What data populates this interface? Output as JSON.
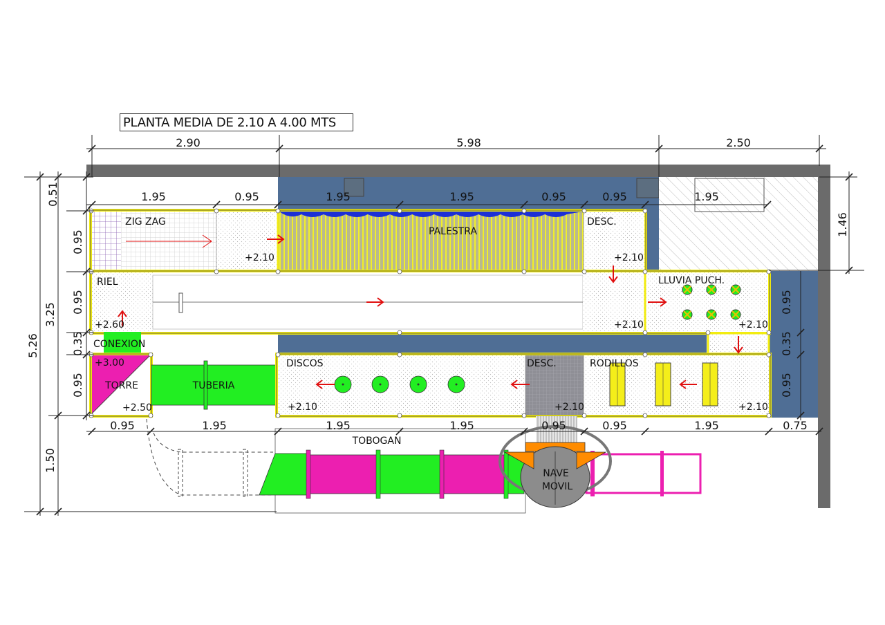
{
  "title": "PLANTA MEDIA DE 2.10 A 4.00 MTS",
  "colors": {
    "wall": "#6b6b6b",
    "blue": "#4f6e95",
    "yellow": "#f4ee1a",
    "green": "#22ee22",
    "magenta": "#ec1fb0",
    "orange": "#ff8c00",
    "arrow": "#e01010",
    "disc_gray": "#8c8c8c"
  },
  "dimensions": {
    "top": [
      "2.90",
      "5.98",
      "2.50"
    ],
    "row1": [
      "1.95",
      "0.95",
      "1.95",
      "1.95",
      "0.95",
      "0.95",
      "1.95"
    ],
    "row_bottom": [
      "0.95",
      "1.95",
      "1.95",
      "1.95",
      "0.95",
      "0.95",
      "1.95",
      "0.75"
    ],
    "left_outer": "5.26",
    "left_mid": [
      "3.25",
      "1.50"
    ],
    "left_inner": [
      "0.51",
      "0.95",
      "0.95",
      "0.35",
      "0.95"
    ],
    "right": [
      "1.46",
      "0.95",
      "0.35",
      "0.95"
    ]
  },
  "labels": {
    "zigzag": "ZIG ZAG",
    "palestra": "PALESTRA",
    "desc_top": "DESC.",
    "riel": "RIEL",
    "lluvia": "LLUVIA PUCH.",
    "conexion": "CONEXION",
    "torre": "TORRE",
    "tuberia": "TUBERIA",
    "discos": "DISCOS",
    "desc_bottom": "DESC.",
    "rodillos": "RODILLOS",
    "tobogan": "TOBOGAN",
    "nave": "NAVE",
    "movil": "MOVIL"
  },
  "levels": {
    "zigzag": "+2.10",
    "desc_top": "+2.10",
    "riel": "+2.60",
    "lluvia": "+2.10",
    "torre_top": "+3.00",
    "torre_bottom": "+2.50",
    "discos": "+2.10",
    "desc_bottom": "+2.10",
    "rodillos": "+2.10"
  }
}
